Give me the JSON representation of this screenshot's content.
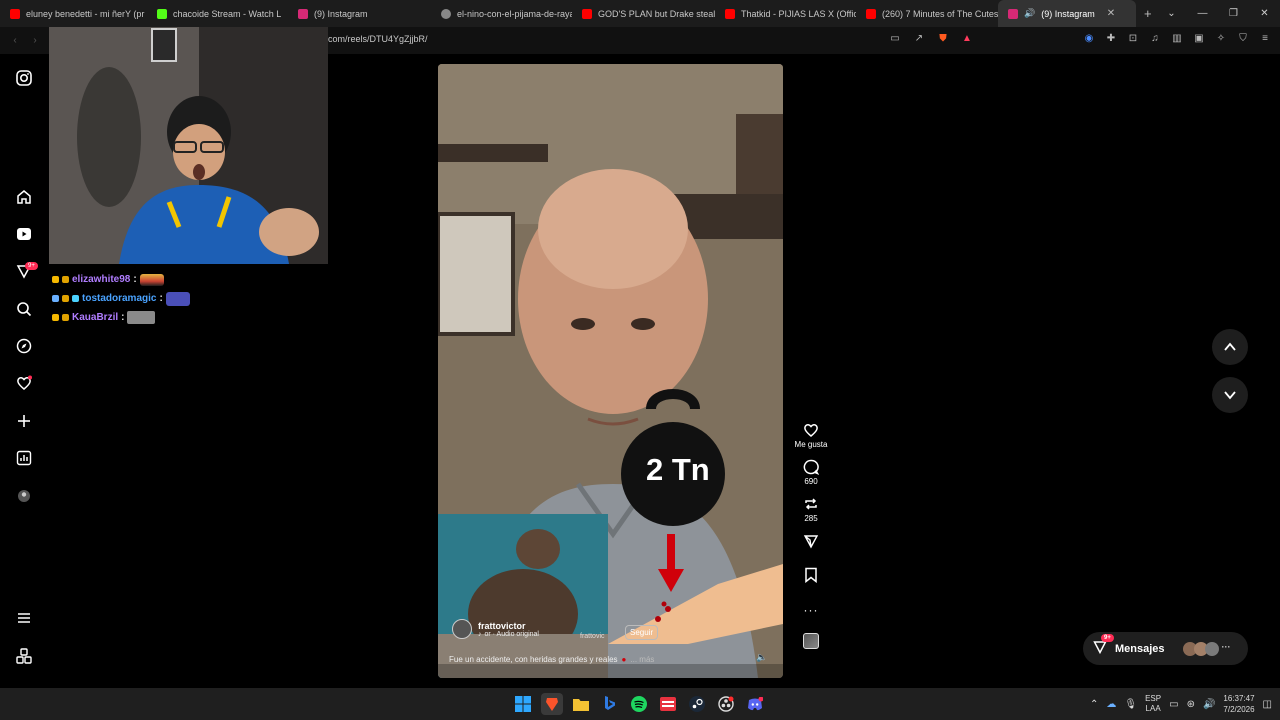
{
  "tabs": [
    {
      "title": "eluney benedetti - mi ñerY (pr",
      "color": "#ff0000"
    },
    {
      "title": "chacoide Stream - Watch L",
      "color": "#53fc18"
    },
    {
      "title": "(9) Instagram",
      "color": "#d62976"
    },
    {
      "title": "el-nino-con-el-pijama-de-raya",
      "color": "#888888"
    },
    {
      "title": "GOD'S PLAN but Drake steals a",
      "color": "#ff0000"
    },
    {
      "title": "Thatkid - PIJIAS LAS X (Official V",
      "color": "#ff0000"
    },
    {
      "title": "(260) 7 Minutes of The Cutest",
      "color": "#ff0000"
    },
    {
      "title": "(9) Instagram",
      "color": "#d62976",
      "active": true
    }
  ],
  "address": {
    "url": "com/reels/DTU4YgZjjbR/"
  },
  "chat": [
    {
      "user": "elizawhite98",
      "color": "#b07dff"
    },
    {
      "user": "tostadoramagic",
      "color": "#4aa3ff"
    },
    {
      "user": "KauaBrzil",
      "color": "#b07dff"
    }
  ],
  "reel": {
    "overlay_text": "2 Tn",
    "author": "frattovictor",
    "audio": "or · Audio original",
    "audio_tag": "frattovic",
    "follow_label": "Seguir",
    "caption": "Fue un accidente, con heridas grandes y reales",
    "more": "... más"
  },
  "actions": {
    "like_label": "Me gusta",
    "comments": "690",
    "reposts": "285"
  },
  "messages": {
    "label": "Mensajes",
    "badge": "9+"
  },
  "sidebar": {
    "badge": "9+"
  },
  "system": {
    "lang1": "ESP",
    "lang2": "LAA",
    "time": "16:37:47",
    "date": "7/2/2026"
  }
}
